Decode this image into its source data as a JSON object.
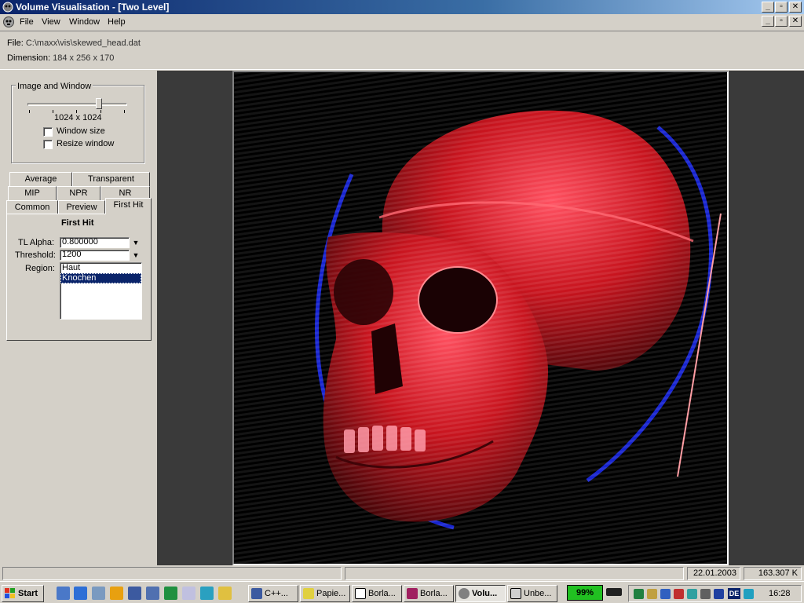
{
  "window": {
    "title": "Volume Visualisation - [Two Level]",
    "controls": [
      "_",
      "▫",
      "✕"
    ],
    "doc_controls": [
      "_",
      "▫",
      "✕"
    ]
  },
  "menu": [
    "File",
    "View",
    "Window",
    "Help"
  ],
  "info": {
    "file_label": "File:",
    "file_value": "C:\\maxx\\vis\\skewed_head.dat",
    "dim_label": "Dimension:",
    "dim_value": "184 x 256 x 170"
  },
  "image_window": {
    "title": "Image and Window",
    "resolution": "1024 x 1024",
    "slider_level": 0.73,
    "window_size_label": "Window size",
    "window_size_checked": false,
    "resize_window_label": "Resize window",
    "resize_window_checked": false
  },
  "tabs": {
    "row1": [
      "Average",
      "Transparent"
    ],
    "row2": [
      "MIP",
      "NPR",
      "NR"
    ],
    "row3": [
      "Common",
      "Preview",
      "First Hit"
    ],
    "active": "First Hit"
  },
  "first_hit": {
    "heading": "First Hit",
    "tl_alpha_label": "TL Alpha:",
    "tl_alpha_value": "0.800000",
    "threshold_label": "Threshold:",
    "threshold_value": "1200",
    "region_label": "Region:",
    "regions": [
      "Haut",
      "Knochen"
    ],
    "selected_region": "Knochen"
  },
  "status": {
    "date": "22.01.2003",
    "size": "163.307 K"
  },
  "taskbar": {
    "start_label": "Start",
    "buttons": [
      "C++...",
      "Papie...",
      "Borla...",
      "Borla...",
      "Volu...",
      "Unbe..."
    ],
    "active_button": "Volu...",
    "battery": "99%",
    "lang": "DE",
    "clock": "16:28"
  },
  "colors": {
    "title_active": "#0a246a",
    "selection": "#0a246a",
    "face": "#d4d0c8",
    "render_bg": "#000000",
    "skull_red": "#c8141e",
    "skin_blue": "#1a28e6",
    "battery_green": "#21c021"
  }
}
